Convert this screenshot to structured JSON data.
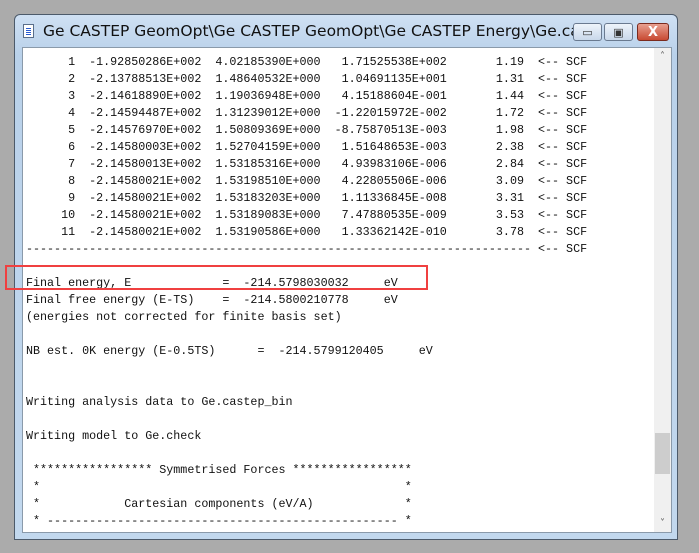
{
  "window": {
    "title": "Ge CASTEP GeomOpt\\Ge CASTEP GeomOpt\\Ge CASTEP Energy\\Ge.cas...",
    "minimize_label": "▭",
    "maximize_label": "▣",
    "close_label": "X"
  },
  "scf_table": [
    "      1  -1.92850286E+002  4.02185390E+000   1.71525538E+002       1.19  <-- SCF",
    "      2  -2.13788513E+002  1.48640532E+000   1.04691135E+001       1.31  <-- SCF",
    "      3  -2.14618890E+002  1.19036948E+000   4.15188604E-001       1.44  <-- SCF",
    "      4  -2.14594487E+002  1.31239012E+000  -1.22015972E-002       1.72  <-- SCF",
    "      5  -2.14576970E+002  1.50809369E+000  -8.75870513E-003       1.98  <-- SCF",
    "      6  -2.14580003E+002  1.52704159E+000   1.51648653E-003       2.38  <-- SCF",
    "      7  -2.14580013E+002  1.53185316E+000   4.93983106E-006       2.84  <-- SCF",
    "      8  -2.14580021E+002  1.53198510E+000   4.22805506E-006       3.09  <-- SCF",
    "      9  -2.14580021E+002  1.53183203E+000   1.11336845E-008       3.31  <-- SCF",
    "     10  -2.14580021E+002  1.53189083E+000   7.47880535E-009       3.53  <-- SCF",
    "     11  -2.14580021E+002  1.53190586E+000   1.33362142E-010       3.78  <-- SCF",
    "------------------------------------------------------------------------ <-- SCF"
  ],
  "results": {
    "final_energy": "Final energy, E             =  -214.5798030032     eV",
    "final_free_energy": "Final free energy (E-TS)    =  -214.5800210778     eV",
    "note": "(energies not corrected for finite basis set)",
    "nb_energy": "NB est. 0K energy (E-0.5TS)      =  -214.5799120405     eV",
    "writing_analysis": "Writing analysis data to Ge.castep_bin",
    "writing_model": "Writing model to Ge.check"
  },
  "forces": [
    " ***************** Symmetrised Forces *****************",
    " *                                                    *",
    " *            Cartesian components (eV/A)             *",
    " * -------------------------------------------------- *"
  ],
  "colors": {
    "highlight": "#f04040"
  }
}
